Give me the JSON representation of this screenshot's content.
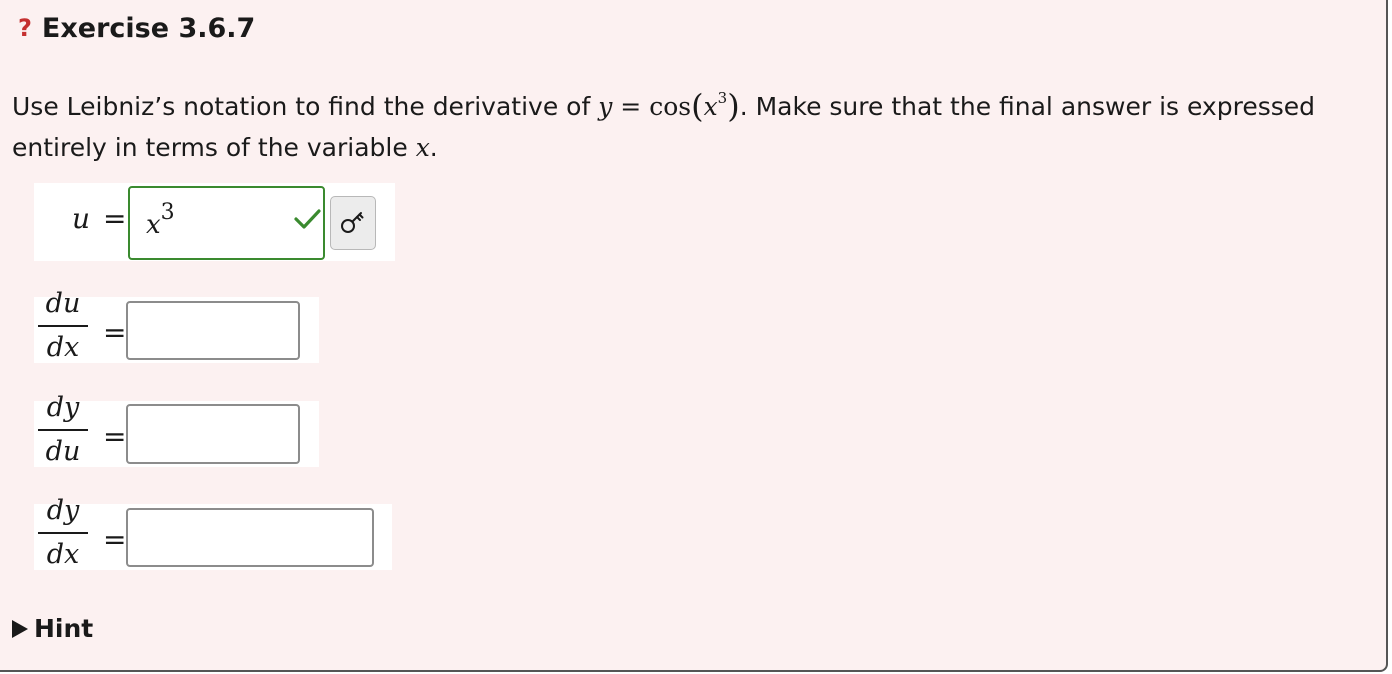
{
  "exercise": {
    "status_icon": "?",
    "title": "Exercise 3.6.7"
  },
  "prompt": {
    "part1": "Use Leibniz’s notation to find the derivative of",
    "eq_y": "y",
    "eq_sign": "=",
    "eq_cos": "cos",
    "eq_lparen": "(",
    "eq_x": "x",
    "eq_exp": "3",
    "eq_rparen": ")",
    "part2": ". Make sure that the final answer is expressed entirely in terms of the variable",
    "var": "x",
    "end": "."
  },
  "rows": {
    "u": {
      "lhs": "u",
      "eq": "=",
      "answer_base": "x",
      "answer_exp": "3",
      "status": "correct"
    },
    "du_dx": {
      "num": "du",
      "den": "dx",
      "eq": "=",
      "value": ""
    },
    "dy_du": {
      "num": "dy",
      "den": "du",
      "eq": "=",
      "value": ""
    },
    "dy_dx": {
      "num": "dy",
      "den": "dx",
      "eq": "=",
      "value": ""
    }
  },
  "hint": {
    "label": "Hint"
  },
  "colors": {
    "status_icon": "#c53030",
    "panel_bg": "#fcf1f1",
    "correct_border": "#3a8a2f",
    "check": "#3a8a2f"
  },
  "icons": {
    "status": "question-mark-icon",
    "correct": "check-icon",
    "key": "key-icon",
    "hint": "triangle-right-icon"
  }
}
